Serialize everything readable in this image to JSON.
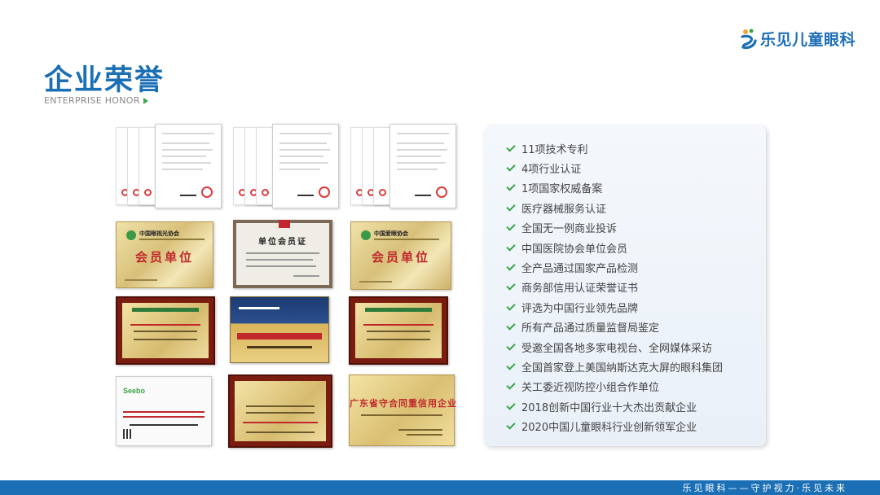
{
  "brand": {
    "name": "乐见儿童眼科",
    "colors": {
      "primary": "#1a6fb5",
      "accent_green": "#3aa548",
      "accent_orange": "#f2a33a"
    }
  },
  "header": {
    "title": "企业荣誉",
    "subtitle": "ENTERPRISE HONOR"
  },
  "certificates": {
    "plaque_1": {
      "title": "中国眼视光协会",
      "main": "会员单位"
    },
    "plaque_2": {
      "title": "单位会员证"
    },
    "plaque_3": {
      "title": "中国爱眼协会",
      "main": "会员单位"
    },
    "plaque_4": {
      "brand": "Seebo"
    },
    "plaque_5": {
      "main": "广东省守合同重信用企业"
    }
  },
  "honors": [
    "11项技术专利",
    "4项行业认证",
    "1项国家权威备案",
    "医疗器械服务认证",
    "全国无一例商业投诉",
    "中国医院协会单位会员",
    "全产品通过国家产品检测",
    "商务部信用认证荣誉证书",
    "评选为中国行业领先品牌",
    "所有产品通过质量监督局鉴定",
    "受邀全国各地多家电视台、全网媒体采访",
    "全国首家登上美国纳斯达克大屏的眼科集团",
    "关工委近视防控小组合作单位",
    "2018创新中国行业十大杰出贡献企业",
    "2020中国儿童眼科行业创新领军企业"
  ],
  "footer": {
    "slogan": "乐见眼科——守护视力·乐见未来"
  }
}
